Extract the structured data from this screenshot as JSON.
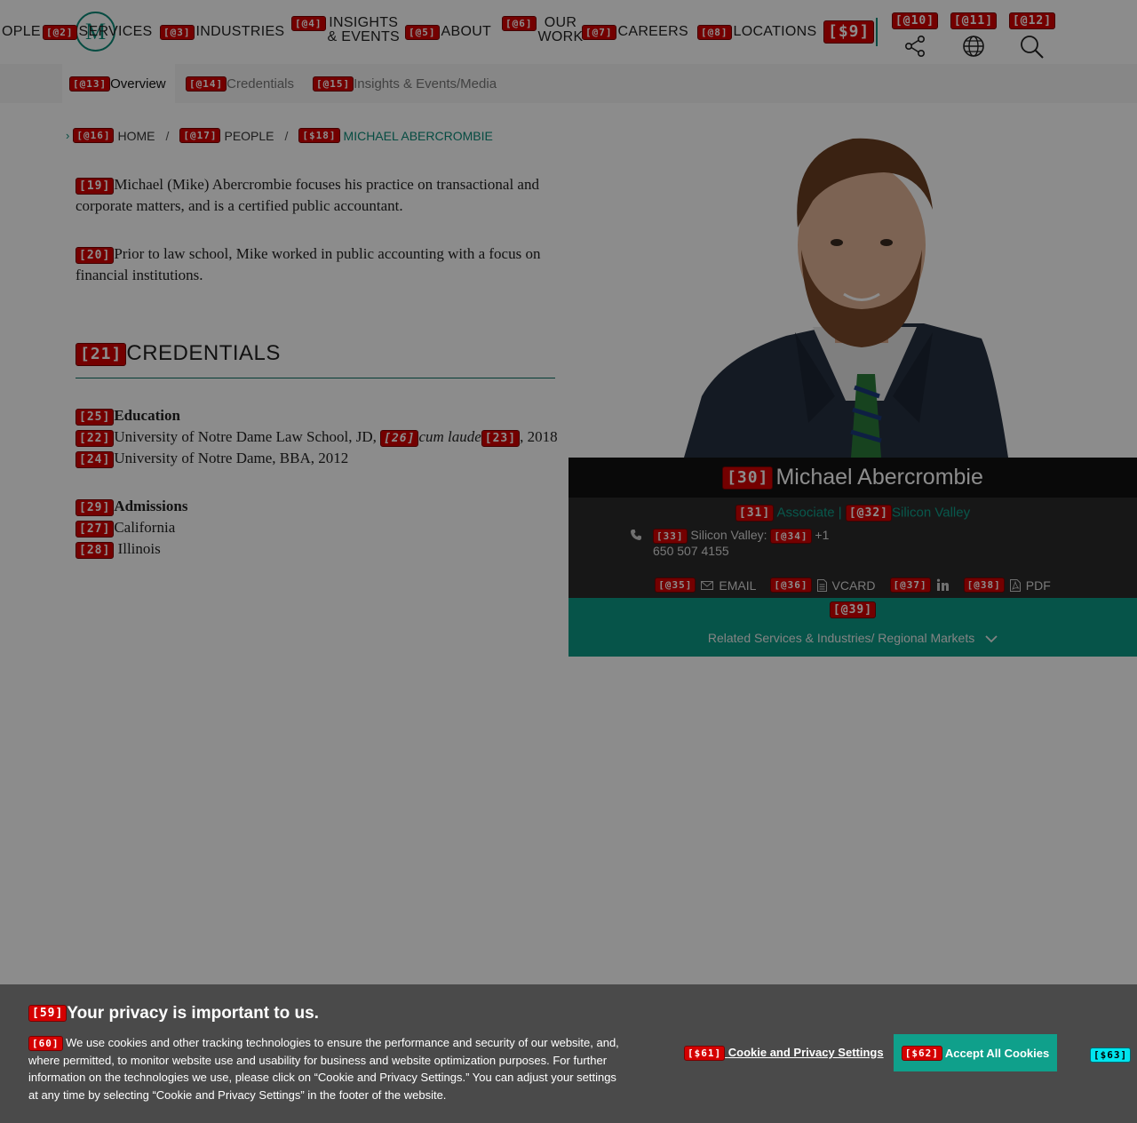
{
  "nav": {
    "people_partial": "OPLE",
    "services": "SERVICES",
    "industries": "INDUSTRIES",
    "insights": "INSIGHTS\n& EVENTS",
    "about": "ABOUT",
    "our_work": "OUR\nWORK",
    "careers": "CAREERS",
    "locations": "LOCATIONS",
    "logo_letter": "M"
  },
  "tags": {
    "services": "[@2]",
    "industries": "[@3]",
    "insights": "[@4]",
    "about": "[@5]",
    "our_work": "[@6]",
    "careers": "[@7]",
    "locations": "[@8]",
    "nine": "[$9]",
    "share": "[@10]",
    "globe": "[@11]",
    "search": "[@12]",
    "tab_overview": "[@13]",
    "tab_credentials": "[@14]",
    "tab_insights": "[@15]",
    "bc_home": "[@16]",
    "bc_people": "[@17]",
    "bc_current": "[$18]",
    "p1": "[19]",
    "p2": "[20]",
    "cred_head": "[21]",
    "edu_head": "[25]",
    "edu1": "[22]",
    "cum_laude": "[26]",
    "edu1b": "[23]",
    "edu2": "[24]",
    "adm_head": "[29]",
    "adm1": "[27]",
    "adm2": "[28]",
    "name": "[30]",
    "role": "[31]",
    "office": "[@32]",
    "phone_label": "[33]",
    "phone_num": "[@34]",
    "email": "[@35]",
    "vcard": "[@36]",
    "linkedin": "[@37]",
    "pdf": "[@38]",
    "related": "[@39]",
    "cookie_title": "[59]",
    "cookie_body": "[60]",
    "cookie_settings": "[$61]",
    "cookie_accept": "[$62]",
    "cookie_close": "[$63]"
  },
  "subnav": {
    "overview": "Overview",
    "credentials": "Credentials",
    "insights": "Insights & Events/Media"
  },
  "breadcrumb": {
    "home": "HOME",
    "people": "PEOPLE",
    "current": "MICHAEL ABERCROMBIE",
    "sep": "/"
  },
  "bio": {
    "p1": "Michael (Mike) Abercrombie focuses his practice on transactional and corporate matters, and is a certified public accountant.",
    "p2": "Prior to law school, Mike worked in public accounting with a focus on financial institutions."
  },
  "credentials": {
    "heading": "CREDENTIALS",
    "education_label": "Education",
    "edu1_main": "University of Notre Dame Law School, JD, ",
    "edu1_honor": "cum laude",
    "edu1_year": ", 2018",
    "edu2": "University of Notre Dame, BBA, 2012",
    "admissions_label": "Admissions",
    "adm1": "California",
    "adm2": " Illinois"
  },
  "profile": {
    "name": "Michael Abercrombie",
    "role": "Associate",
    "role_sep": "|",
    "office": "Silicon Valley",
    "phone_label": "Silicon Valley:",
    "phone_prefix": "+1",
    "phone_rest": "650 507 4155",
    "email": "EMAIL",
    "vcard": "VCARD",
    "pdf": "PDF",
    "related": "Related Services & Industries/ Regional Markets"
  },
  "cookie": {
    "title": "Your privacy is important to us.",
    "body": "We use cookies and other tracking technologies to ensure the performance and security of our website, and, where permitted, to monitor website use and usability for business and website optimization purposes. For further information on the technologies we use, please click on “Cookie and Privacy Settings.” You can adjust your settings at any time by selecting “Cookie and Privacy Settings” in the footer of the website.",
    "settings": "Cookie and Privacy Settings",
    "accept": "Accept All Cookies"
  },
  "colors": {
    "brand_green": "#0b8a78",
    "accept_button": "#0fa08b",
    "tag_red": "#d40000",
    "tag_cyan": "#00e5ee",
    "banner_bg": "#4a4a4a"
  }
}
